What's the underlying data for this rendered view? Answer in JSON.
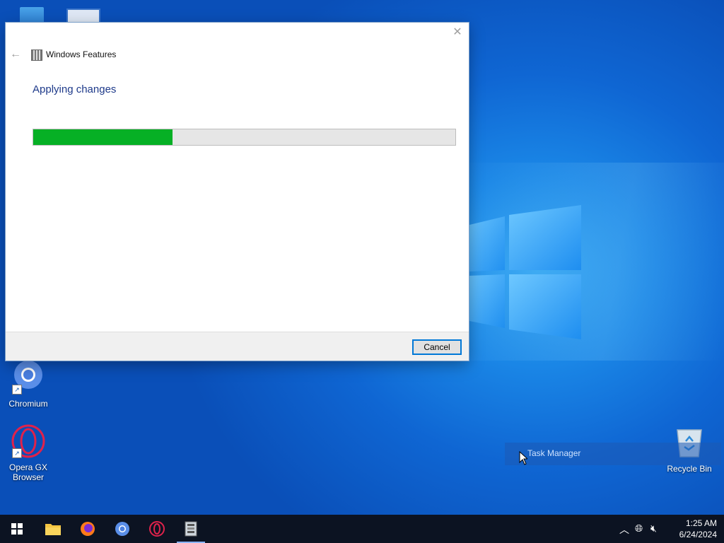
{
  "desktop": {
    "icons": [
      {
        "label": "Chromium",
        "icon": "chromium-icon"
      },
      {
        "label": "Opera GX\nBrowser",
        "icon": "opera-gx-icon"
      },
      {
        "label": "Recycle Bin",
        "icon": "recycle-bin-icon"
      }
    ],
    "task_manager_label": "Task Manager"
  },
  "dialog": {
    "title": "Windows Features",
    "heading": "Applying changes",
    "progress_percent": 33,
    "cancel_label": "Cancel",
    "colors": {
      "progress": "#06b025",
      "heading": "#1e3a8a",
      "button_border": "#0078d7"
    }
  },
  "taskbar": {
    "items": [
      {
        "icon": "start-icon"
      },
      {
        "icon": "file-explorer-icon"
      },
      {
        "icon": "firefox-icon"
      },
      {
        "icon": "chromium-icon"
      },
      {
        "icon": "opera-gx-icon"
      },
      {
        "icon": "windows-features-icon",
        "active": true
      }
    ],
    "clock": {
      "time": "1:25 AM",
      "date": "6/24/2024"
    }
  }
}
